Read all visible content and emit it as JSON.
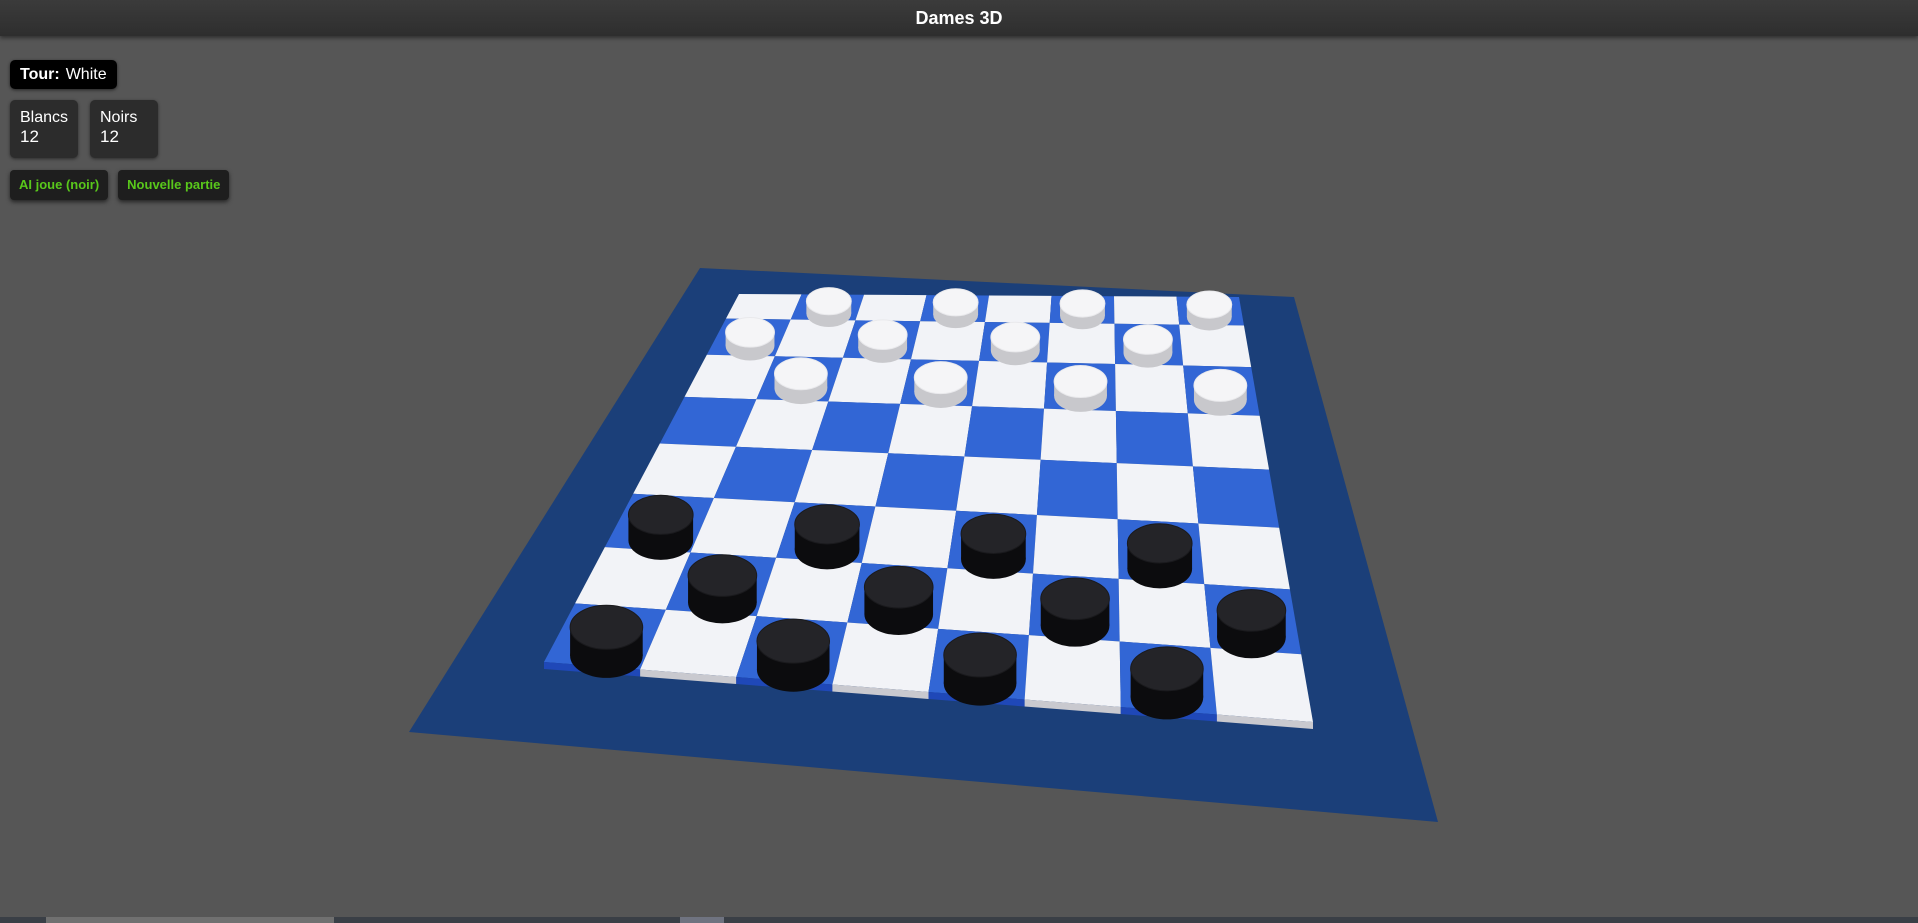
{
  "app": {
    "title": "Dames 3D"
  },
  "hud": {
    "turn_label": "Tour:",
    "turn_value": "White",
    "white_label": "Blancs",
    "white_count": "12",
    "black_label": "Noirs",
    "black_count": "12",
    "ai_button": "AI joue (noir)",
    "new_game_button": "Nouvelle partie"
  },
  "board": {
    "size": 8,
    "frame_color": "#1b3f79",
    "dark_square_color": "#3266d5",
    "light_square_color": "#f2f3f7",
    "white_piece_color": "#e9e9ec",
    "black_piece_color": "#1a1a1d",
    "white_pieces": [
      {
        "row": 0,
        "col": 1
      },
      {
        "row": 0,
        "col": 3
      },
      {
        "row": 0,
        "col": 5
      },
      {
        "row": 0,
        "col": 7
      },
      {
        "row": 1,
        "col": 0
      },
      {
        "row": 1,
        "col": 2
      },
      {
        "row": 1,
        "col": 4
      },
      {
        "row": 1,
        "col": 6
      },
      {
        "row": 2,
        "col": 1
      },
      {
        "row": 2,
        "col": 3
      },
      {
        "row": 2,
        "col": 5
      },
      {
        "row": 2,
        "col": 7
      }
    ],
    "black_pieces": [
      {
        "row": 5,
        "col": 0
      },
      {
        "row": 5,
        "col": 2
      },
      {
        "row": 5,
        "col": 4
      },
      {
        "row": 5,
        "col": 6
      },
      {
        "row": 6,
        "col": 1
      },
      {
        "row": 6,
        "col": 3
      },
      {
        "row": 6,
        "col": 5
      },
      {
        "row": 6,
        "col": 7
      },
      {
        "row": 7,
        "col": 0
      },
      {
        "row": 7,
        "col": 2
      },
      {
        "row": 7,
        "col": 4
      },
      {
        "row": 7,
        "col": 6
      }
    ]
  }
}
